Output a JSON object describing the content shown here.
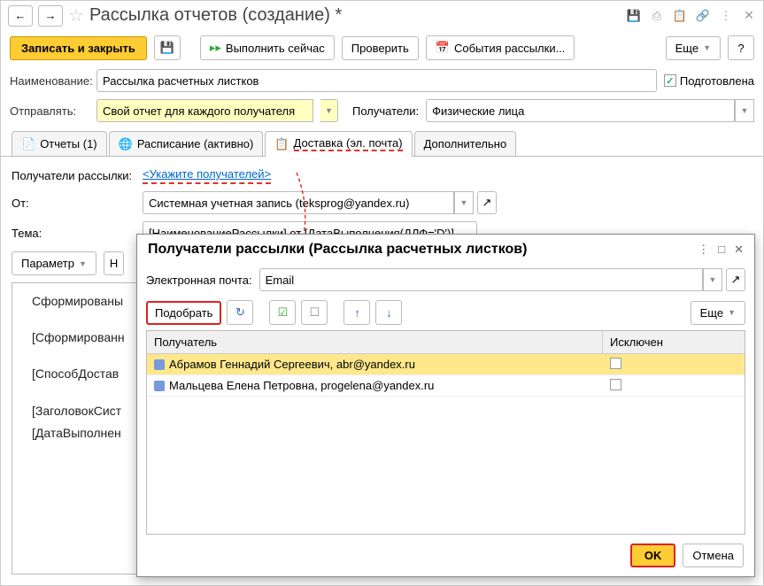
{
  "header": {
    "title": "Рассылка отчетов (создание) *"
  },
  "toolbar": {
    "save_close": "Записать и закрыть",
    "execute": "Выполнить сейчас",
    "check": "Проверить",
    "events": "События рассылки...",
    "more": "Еще"
  },
  "form": {
    "name_label": "Наименование:",
    "name_value": "Рассылка расчетных листков",
    "prepared_label": "Подготовлена",
    "send_label": "Отправлять:",
    "send_value": "Свой отчет для каждого получателя",
    "recipients_label": "Получатели:",
    "recipients_value": "Физические лица"
  },
  "tabs": {
    "reports": "Отчеты (1)",
    "schedule": "Расписание (активно)",
    "delivery": "Доставка (эл. почта)",
    "additional": "Дополнительно"
  },
  "delivery": {
    "recipients_label": "Получатели рассылки:",
    "recipients_link": "<Укажите получателей>",
    "from_label": "От:",
    "from_value": "Системная учетная запись (teksprog@yandex.ru)",
    "subject_label": "Тема:",
    "subject_value": "[НаименованиеРассылки] от [ДатаВыполнения(ДЛФ='D')]",
    "params_btn": "Параметр",
    "body1": "Сформированы",
    "body2": "[Сформированн",
    "body3": "[СпособДостав",
    "body4": "[ЗаголовокСист",
    "body5": "[ДатаВыполнен"
  },
  "modal": {
    "title": "Получатели рассылки (Рассылка расчетных листков)",
    "email_label": "Электронная почта:",
    "email_value": "Email",
    "select_btn": "Подобрать",
    "more": "Еще",
    "col_recipient": "Получатель",
    "col_excluded": "Исключен",
    "rows": [
      "Абрамов Геннадий Сергеевич, abr@yandex.ru",
      "Мальцева Елена Петровна, progelena@yandex.ru"
    ],
    "ok": "OK",
    "cancel": "Отмена"
  }
}
